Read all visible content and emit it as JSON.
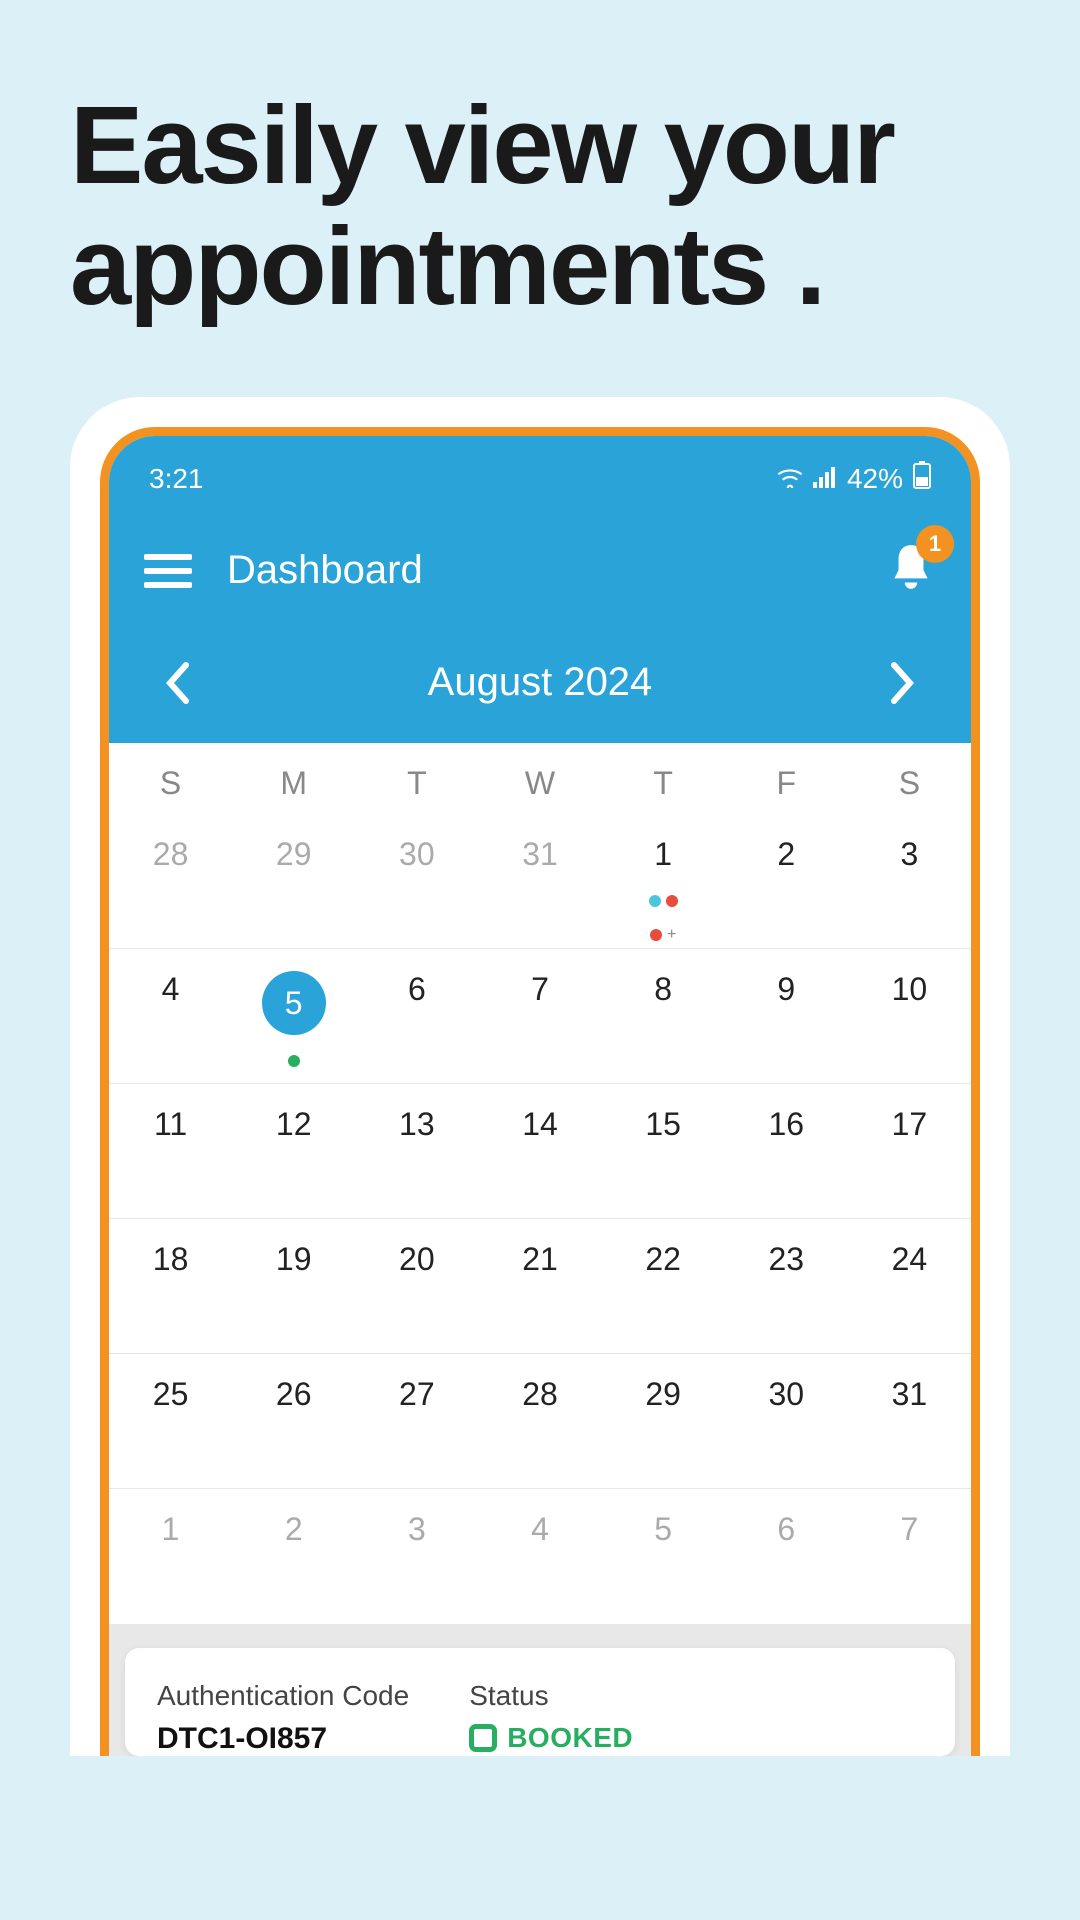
{
  "hero": {
    "title": "Easily view your appointments ."
  },
  "statusbar": {
    "time": "3:21",
    "battery": "42%"
  },
  "header": {
    "title": "Dashboard",
    "notification_count": "1"
  },
  "calendar": {
    "month_label": "August  2024",
    "day_headers": [
      "S",
      "M",
      "T",
      "W",
      "T",
      "F",
      "S"
    ],
    "weeks": [
      [
        {
          "n": "28",
          "muted": true
        },
        {
          "n": "29",
          "muted": true
        },
        {
          "n": "30",
          "muted": true
        },
        {
          "n": "31",
          "muted": true
        },
        {
          "n": "1",
          "dots": [
            "cyan",
            "red",
            "red"
          ],
          "plus": true
        },
        {
          "n": "2"
        },
        {
          "n": "3"
        }
      ],
      [
        {
          "n": "4"
        },
        {
          "n": "5",
          "selected": true,
          "singleDot": true
        },
        {
          "n": "6"
        },
        {
          "n": "7"
        },
        {
          "n": "8"
        },
        {
          "n": "9"
        },
        {
          "n": "10"
        }
      ],
      [
        {
          "n": "11"
        },
        {
          "n": "12"
        },
        {
          "n": "13"
        },
        {
          "n": "14"
        },
        {
          "n": "15"
        },
        {
          "n": "16"
        },
        {
          "n": "17"
        }
      ],
      [
        {
          "n": "18"
        },
        {
          "n": "19"
        },
        {
          "n": "20"
        },
        {
          "n": "21"
        },
        {
          "n": "22"
        },
        {
          "n": "23"
        },
        {
          "n": "24"
        }
      ],
      [
        {
          "n": "25"
        },
        {
          "n": "26"
        },
        {
          "n": "27"
        },
        {
          "n": "28"
        },
        {
          "n": "29"
        },
        {
          "n": "30"
        },
        {
          "n": "31"
        }
      ],
      [
        {
          "n": "1",
          "muted": true
        },
        {
          "n": "2",
          "muted": true
        },
        {
          "n": "3",
          "muted": true
        },
        {
          "n": "4",
          "muted": true
        },
        {
          "n": "5",
          "muted": true
        },
        {
          "n": "6",
          "muted": true
        },
        {
          "n": "7",
          "muted": true
        }
      ]
    ]
  },
  "card": {
    "auth_label": "Authentication Code",
    "auth_value": "DTC1-OI857",
    "status_label": "Status",
    "status_value": "BOOKED"
  }
}
